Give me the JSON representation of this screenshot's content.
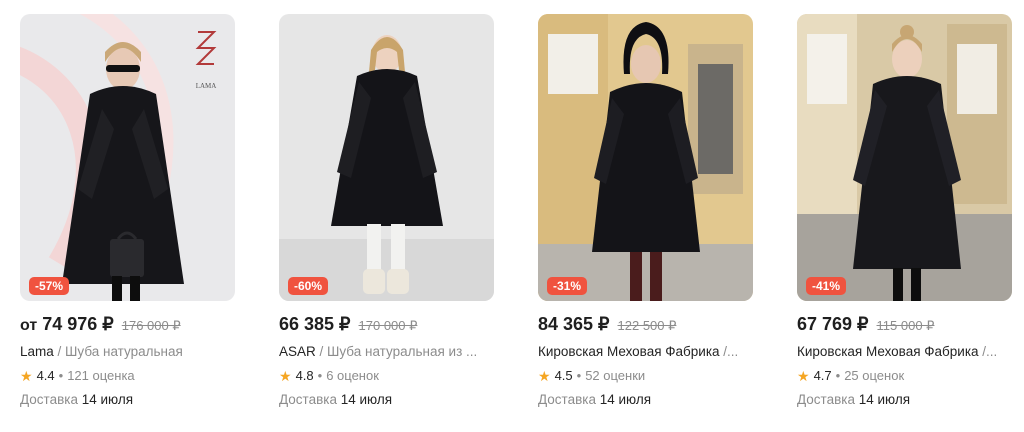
{
  "products": [
    {
      "discount": "-57%",
      "price_prefix": "от",
      "price": "74 976 ₽",
      "old_price": "176 000 ₽",
      "brand": "Lama",
      "separator": " / ",
      "type": "Шуба натуральная",
      "rating": "4.4",
      "dot": "•",
      "reviews": "121 оценка",
      "delivery_label": "Доставка",
      "delivery_date": "14 июля",
      "logo_text": "LAMA",
      "icon": "star-icon"
    },
    {
      "discount": "-60%",
      "price_prefix": "",
      "price": "66 385 ₽",
      "old_price": "170 000 ₽",
      "brand": "ASAR",
      "separator": " / ",
      "type": "Шуба натуральная из ...",
      "rating": "4.8",
      "dot": "•",
      "reviews": "6 оценок",
      "delivery_label": "Доставка",
      "delivery_date": "14 июля"
    },
    {
      "discount": "-31%",
      "price_prefix": "",
      "price": "84 365 ₽",
      "old_price": "122 500 ₽",
      "brand": "Кировская Меховая Фабрика",
      "separator": " /...",
      "type": "",
      "rating": "4.5",
      "dot": "•",
      "reviews": "52 оценки",
      "delivery_label": "Доставка",
      "delivery_date": "14 июля"
    },
    {
      "discount": "-41%",
      "price_prefix": "",
      "price": "67 769 ₽",
      "old_price": "115 000 ₽",
      "brand": "Кировская Меховая Фабрика",
      "separator": " /...",
      "type": "",
      "rating": "4.7",
      "dot": "•",
      "reviews": "25 оценок",
      "delivery_label": "Доставка",
      "delivery_date": "14 июля"
    }
  ],
  "colors": {
    "discount_badge": "#f0533f",
    "star": "#f5a623",
    "muted_text": "#8c8c8c"
  }
}
